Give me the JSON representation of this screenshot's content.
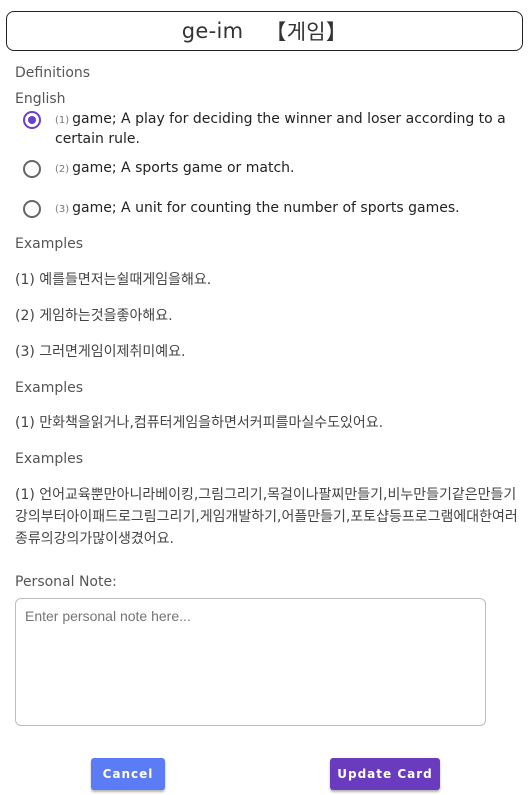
{
  "header": {
    "romanization": "ge-im",
    "word": "【게임】"
  },
  "labels": {
    "definitions": "Definitions",
    "language": "English",
    "examples": "Examples",
    "personal_note": "Personal Note:"
  },
  "definitions": [
    {
      "num": "(1)",
      "text": "game; A play for deciding the winner and loser according to a certain rule.",
      "selected": true
    },
    {
      "num": "(2)",
      "text": "game; A sports game or match.",
      "selected": false
    },
    {
      "num": "(3)",
      "text": "game; A unit for counting the number of sports games.",
      "selected": false
    }
  ],
  "example_groups": [
    [
      "(1) 예를들면저는쉴때게임을해요.",
      "(2) 게임하는것을좋아해요.",
      "(3) 그러면게임이제취미예요."
    ],
    [
      "(1) 만화책을읽거나,컴퓨터게임을하면서커피를마실수도있어요."
    ],
    [
      "(1) 언어교육뿐만아니라베이킹,그림그리기,목걸이나팔찌만들기,비누만들기같은만들기강의부터아이패드로그림그리기,게임개발하기,어플만들기,포토샵등프로그램에대한여러종류의강의가많이생겼어요."
    ]
  ],
  "note": {
    "placeholder": "Enter personal note here..."
  },
  "buttons": {
    "cancel": "Cancel",
    "update": "Update Card"
  },
  "colors": {
    "accent": "#6a3bbf",
    "cancel": "#5b7cf4"
  }
}
